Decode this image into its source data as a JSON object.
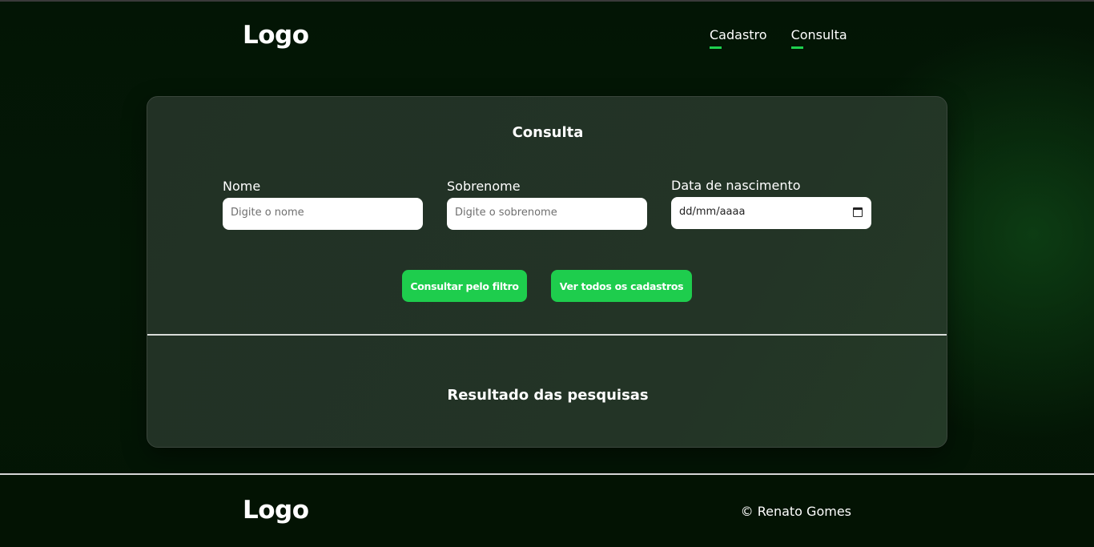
{
  "header": {
    "logo": "Logo",
    "nav": [
      {
        "label": "Cadastro"
      },
      {
        "label": "Consulta"
      }
    ]
  },
  "form": {
    "title": "Consulta",
    "fields": [
      {
        "label": "Nome",
        "placeholder": "Digite o nome"
      },
      {
        "label": "Sobrenome",
        "placeholder": "Digite o sobrenome"
      },
      {
        "label": "Data de nascimento",
        "placeholder": "dd/mm/aaaa"
      }
    ],
    "buttons": {
      "filter": "Consultar pelo filtro",
      "all": "Ver todos os cadastros"
    }
  },
  "results": {
    "title": "Resultado das pesquisas"
  },
  "footer": {
    "logo": "Logo",
    "copyright": "© Renato Gomes"
  },
  "colors": {
    "accent": "#1ecd4d",
    "background": "#041406",
    "card": "#223125"
  }
}
